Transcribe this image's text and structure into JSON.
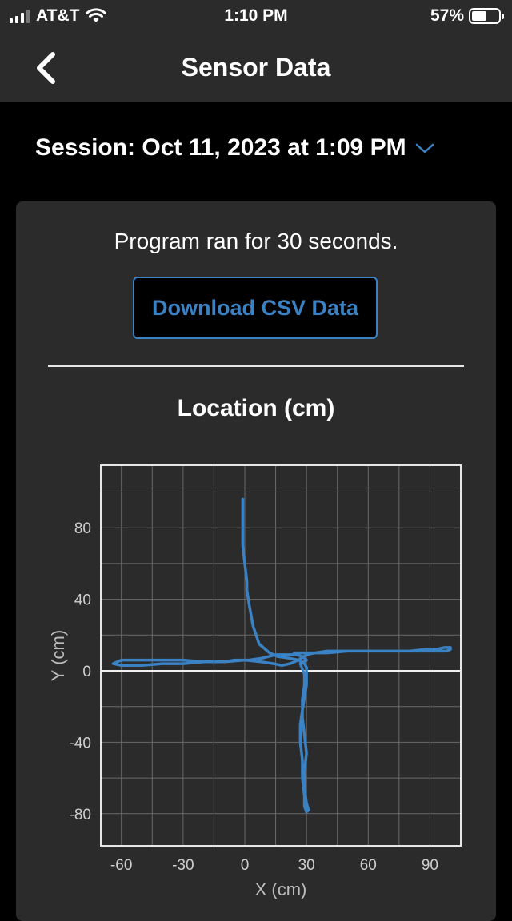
{
  "status_bar": {
    "carrier": "AT&T",
    "time": "1:10 PM",
    "battery": "57%",
    "battery_level": 0.57,
    "signal_bars": 3,
    "signal_icon": "cellular-signal-icon",
    "wifi_icon": "wifi-icon",
    "battery_icon": "battery-icon"
  },
  "header": {
    "title": "Sensor Data",
    "back_icon": "chevron-left-icon"
  },
  "session": {
    "label": "Session: Oct 11, 2023 at 1:09 PM",
    "dropdown_icon": "chevron-down-icon"
  },
  "summary": {
    "runtime_text": "Program ran for 30 seconds.",
    "download_label": "Download CSV Data"
  },
  "colors": {
    "accent": "#3b82c4",
    "card_background": "#2b2b2b",
    "page_background": "#000000",
    "line": "#3b82c4"
  },
  "chart_data": {
    "type": "line",
    "title": "Location (cm)",
    "xlabel": "X (cm)",
    "ylabel": "Y (cm)",
    "xlim": [
      -70,
      105
    ],
    "ylim": [
      -98,
      115
    ],
    "xticks": [
      -60,
      -30,
      0,
      30,
      60,
      90
    ],
    "yticks": [
      80,
      40,
      0,
      -40,
      -80
    ],
    "grid": true,
    "series": [
      {
        "x": [
          -1,
          -1,
          -1,
          -1,
          0,
          1,
          1,
          2,
          4,
          7,
          12,
          16,
          22,
          26,
          29,
          30,
          30,
          30,
          29,
          28,
          27,
          27,
          28,
          28,
          29,
          29,
          30,
          31,
          30,
          29,
          29,
          30,
          29,
          28,
          28,
          29,
          29,
          27,
          30,
          28,
          25,
          20,
          15,
          8,
          2,
          -5,
          -10,
          -20,
          -30,
          -40,
          -52,
          -60,
          -64,
          -60,
          -50,
          -40,
          -30,
          -20,
          -10,
          0,
          8,
          14,
          18,
          22,
          26,
          30,
          34,
          40,
          50,
          60,
          70,
          80,
          88,
          93,
          97,
          100,
          100,
          98,
          95,
          90,
          85,
          80,
          70,
          60,
          50,
          40,
          30,
          26,
          24
        ],
        "y": [
          96,
          90,
          80,
          70,
          60,
          50,
          45,
          38,
          25,
          15,
          10,
          8,
          7,
          6,
          4,
          2,
          -2,
          -8,
          -15,
          -22,
          -30,
          -40,
          -50,
          -60,
          -70,
          -76,
          -79,
          -78,
          -74,
          -66,
          -56,
          -46,
          -36,
          -26,
          -16,
          -8,
          -2,
          4,
          6,
          8,
          9,
          9,
          9,
          7,
          6,
          6,
          5,
          5,
          6,
          6,
          6,
          6,
          4,
          3,
          3,
          4,
          4,
          5,
          5,
          6,
          5,
          4,
          3,
          4,
          6,
          9,
          10,
          11,
          11,
          11,
          11,
          11,
          12,
          12,
          13,
          13,
          12,
          11,
          11,
          11,
          11,
          11,
          11,
          11,
          11,
          10,
          10,
          10,
          10
        ]
      }
    ]
  }
}
